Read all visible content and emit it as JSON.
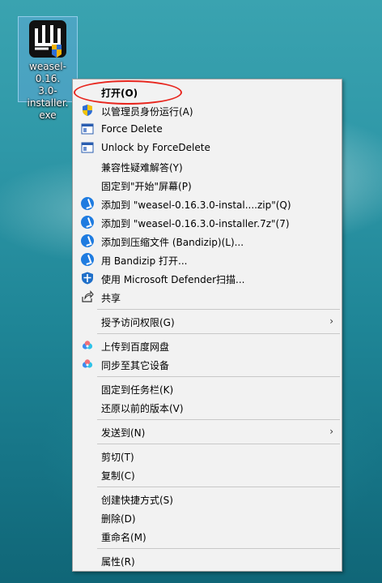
{
  "desktop_icon": {
    "label_lines": [
      "weasel-0.16.",
      "3.0-installer.",
      "exe"
    ]
  },
  "menu": {
    "items": [
      {
        "label": "打开(O)",
        "icon": "none"
      },
      {
        "label": "以管理员身份运行(A)",
        "icon": "uac-shield-icon"
      },
      {
        "label": "Force Delete",
        "icon": "forcedelete-icon"
      },
      {
        "label": "Unlock by ForceDelete",
        "icon": "forcedelete-icon"
      },
      {
        "label": "兼容性疑难解答(Y)",
        "icon": "none"
      },
      {
        "label": "固定到\"开始\"屏幕(P)",
        "icon": "none"
      },
      {
        "label": "添加到 \"weasel-0.16.3.0-instal....zip\"(Q)",
        "icon": "bandizip-icon"
      },
      {
        "label": "添加到 \"weasel-0.16.3.0-installer.7z\"(7)",
        "icon": "bandizip-icon"
      },
      {
        "label": "添加到压缩文件 (Bandizip)(L)...",
        "icon": "bandizip-icon"
      },
      {
        "label": "用 Bandizip 打开...",
        "icon": "bandizip-icon"
      },
      {
        "label": "使用 Microsoft Defender扫描...",
        "icon": "defender-icon"
      },
      {
        "label": "共享",
        "icon": "share-icon"
      },
      {
        "label": "授予访问权限(G)",
        "icon": "none",
        "submenu": true
      },
      {
        "label": "上传到百度网盘",
        "icon": "baidu-netdisk-icon"
      },
      {
        "label": "同步至其它设备",
        "icon": "baidu-netdisk-icon"
      },
      {
        "label": "固定到任务栏(K)",
        "icon": "none"
      },
      {
        "label": "还原以前的版本(V)",
        "icon": "none"
      },
      {
        "label": "发送到(N)",
        "icon": "none",
        "submenu": true
      },
      {
        "label": "剪切(T)",
        "icon": "none"
      },
      {
        "label": "复制(C)",
        "icon": "none"
      },
      {
        "label": "创建快捷方式(S)",
        "icon": "none"
      },
      {
        "label": "删除(D)",
        "icon": "none"
      },
      {
        "label": "重命名(M)",
        "icon": "none"
      },
      {
        "label": "属性(R)",
        "icon": "none"
      }
    ],
    "submenu_arrow": "›"
  },
  "colors": {
    "menu_bg": "#f2f2f2",
    "highlight_oval": "#e8261e",
    "bandizip_blue": "#1e7be0"
  }
}
